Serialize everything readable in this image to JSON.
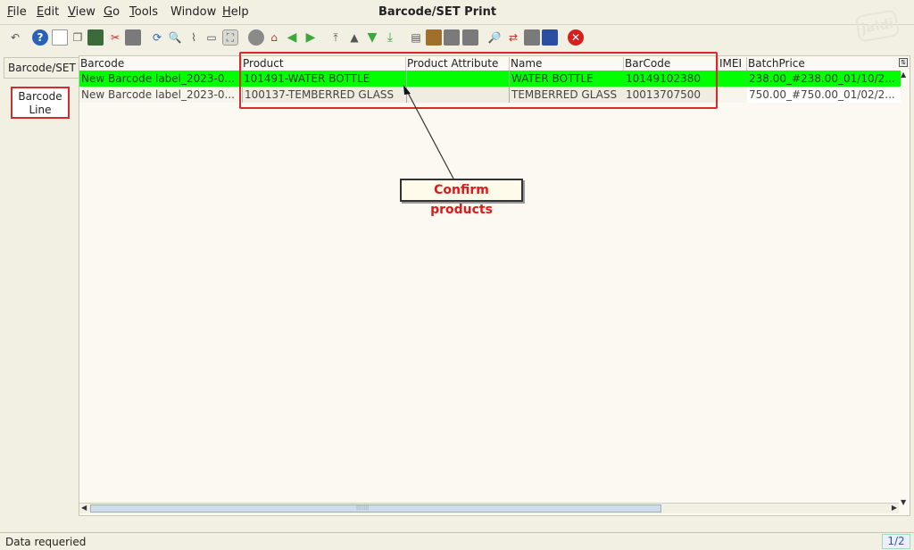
{
  "menu": {
    "items": [
      {
        "mnemonic": "F",
        "rest": "ile"
      },
      {
        "mnemonic": "E",
        "rest": "dit"
      },
      {
        "mnemonic": "V",
        "rest": "iew"
      },
      {
        "mnemonic": "G",
        "rest": "o"
      },
      {
        "mnemonic": "T",
        "rest": "ools"
      },
      {
        "mnemonic": "",
        "rest": "Window"
      },
      {
        "mnemonic": "H",
        "rest": "elp"
      }
    ]
  },
  "window": {
    "title": "Barcode/SET Print"
  },
  "logo": {
    "text": "jaldi"
  },
  "tabs": {
    "parent": "Barcode/SET",
    "child_line1": "Barcode",
    "child_line2": "Line"
  },
  "grid": {
    "columns": [
      "Barcode",
      "Product",
      "Product Attribute",
      "Name",
      "BarCode",
      "IMEI",
      "BatchPrice"
    ],
    "rows": [
      [
        "New Barcode label_2023-0...",
        "101491-WATER BOTTLE",
        "",
        "WATER BOTTLE",
        "10149102380",
        "",
        "238.00_#238.00_01/10/2..."
      ],
      [
        "New Barcode label_2023-0...",
        "100137-TEMBERRED GLASS",
        "",
        "TEMBERRED GLASS",
        "10013707500",
        "",
        "750.00_#750.00_01/02/2..."
      ]
    ]
  },
  "annotation": {
    "callout": "Confirm products",
    "color": "#d32c2c"
  },
  "status": {
    "message": "Data requeried",
    "page": "1/2"
  },
  "colors": {
    "selected_row": "#00ff00",
    "accent": "#2a62b8"
  }
}
